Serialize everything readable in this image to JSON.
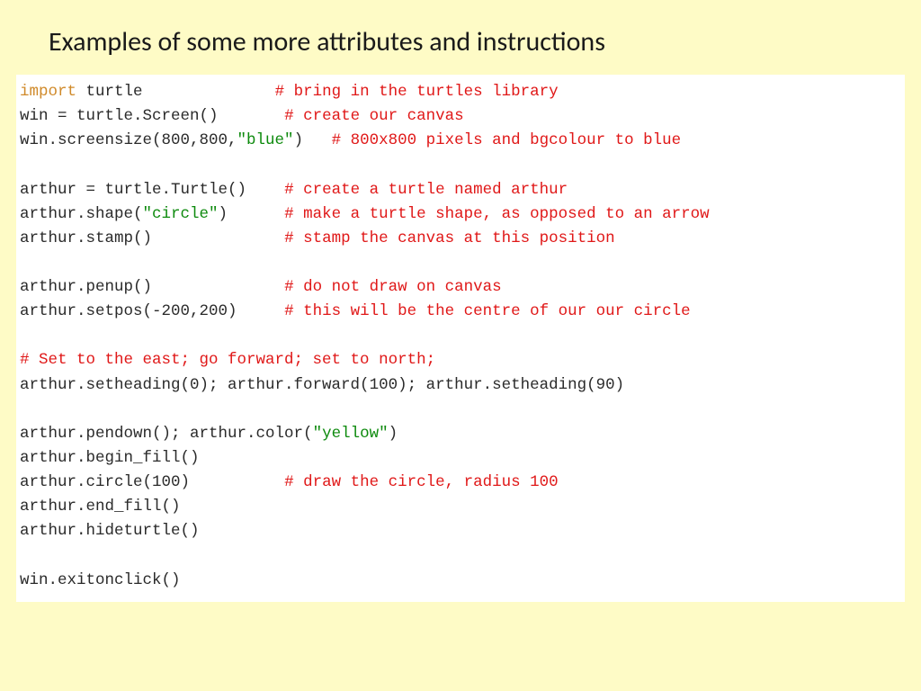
{
  "title": "Examples of some more attributes and instructions",
  "code": {
    "l1_kw": "import",
    "l1_txt": " turtle              ",
    "l1_cm": "# bring in the turtles library",
    "l2_txt": "win = turtle.Screen()       ",
    "l2_cm": "# create our canvas",
    "l3_a": "win.screensize(800,800,",
    "l3_str": "\"blue\"",
    "l3_b": ")   ",
    "l3_cm": "# 800x800 pixels and bgcolour to blue",
    "blank": "",
    "l5_txt": "arthur = turtle.Turtle()    ",
    "l5_cm": "# create a turtle named arthur",
    "l6_a": "arthur.shape(",
    "l6_str": "\"circle\"",
    "l6_b": ")      ",
    "l6_cm": "# make a turtle shape, as opposed to an arrow",
    "l7_txt": "arthur.stamp()              ",
    "l7_cm": "# stamp the canvas at this position",
    "l9_txt": "arthur.penup()              ",
    "l9_cm": "# do not draw on canvas",
    "l10_txt": "arthur.setpos(-200,200)     ",
    "l10_cm": "# this will be the centre of our our circle",
    "l12_cm": "# Set to the east; go forward; set to north;",
    "l13_txt": "arthur.setheading(0); arthur.forward(100); arthur.setheading(90)",
    "l15_a": "arthur.pendown(); arthur.color(",
    "l15_str": "\"yellow\"",
    "l15_b": ")",
    "l16_txt": "arthur.begin_fill()",
    "l17_txt": "arthur.circle(100)          ",
    "l17_cm": "# draw the circle, radius 100",
    "l18_txt": "arthur.end_fill()",
    "l19_txt": "arthur.hideturtle()",
    "l21_txt": "win.exitonclick()"
  }
}
